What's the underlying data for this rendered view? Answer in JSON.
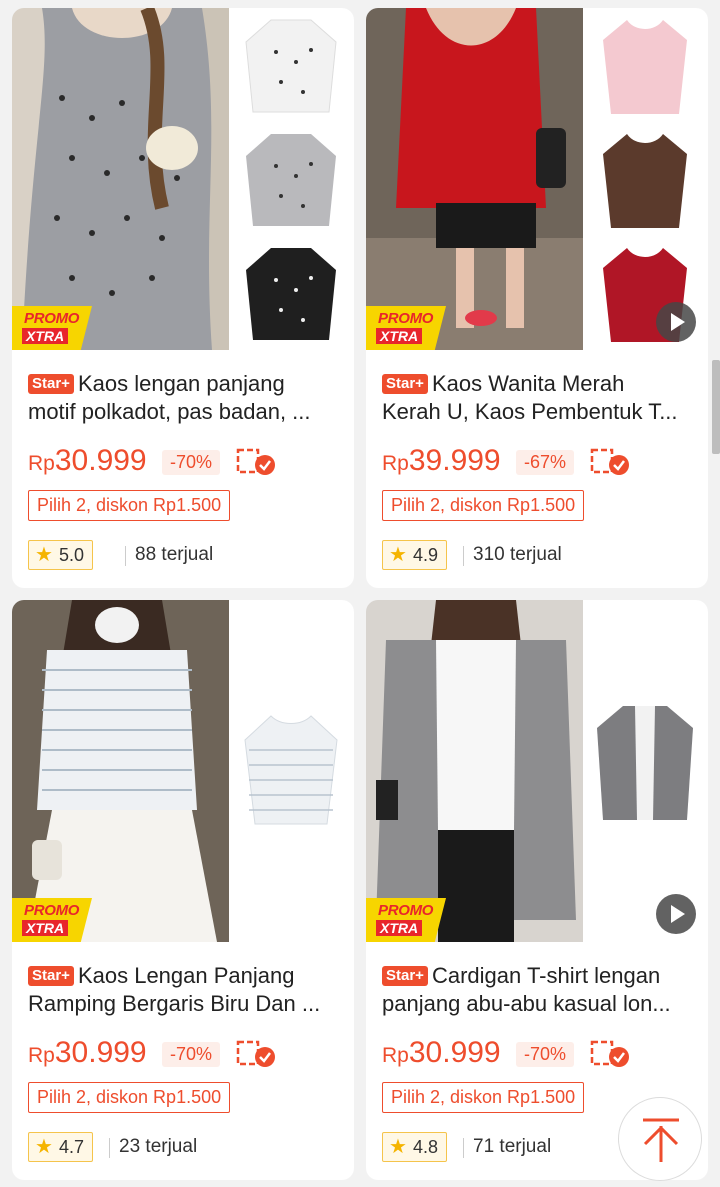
{
  "products": [
    {
      "badge": "Star+",
      "title_line1": "Kaos lengan panjang",
      "title_line2": "motif polkadot, pas badan, ...",
      "currency": "Rp",
      "price": "30.999",
      "discount": "-70%",
      "promo": "Pilih 2, diskon Rp1.500",
      "rating": "5.0",
      "sold": "88 terjual",
      "promo_badge_top": "PROMO",
      "promo_badge_bottom": "XTRA",
      "has_video": false,
      "colors": {
        "main": "#9c9ea3",
        "thumbs": [
          "#f2f2f2",
          "#b9b9bc",
          "#1f1f1f"
        ]
      }
    },
    {
      "badge": "Star+",
      "title_line1": "Kaos Wanita Merah",
      "title_line2": "Kerah U, Kaos Pembentuk T...",
      "currency": "Rp",
      "price": "39.999",
      "discount": "-67%",
      "promo": "Pilih 2, diskon Rp1.500",
      "rating": "4.9",
      "sold": "310 terjual",
      "promo_badge_top": "PROMO",
      "promo_badge_bottom": "XTRA",
      "has_video": true,
      "colors": {
        "main": "#c8161d",
        "thumbs": [
          "#f4c9d0",
          "#5b3a2c",
          "#b01626"
        ]
      }
    },
    {
      "badge": "Star+",
      "title_line1": "Kaos Lengan Panjang",
      "title_line2": "Ramping Bergaris Biru Dan ...",
      "currency": "Rp",
      "price": "30.999",
      "discount": "-70%",
      "promo": "Pilih 2, diskon Rp1.500",
      "rating": "4.7",
      "sold": "23 terjual",
      "promo_badge_top": "PROMO",
      "promo_badge_bottom": "XTRA",
      "has_video": false,
      "colors": {
        "main": "#e8ecef",
        "thumbs": [
          "#eef1f4"
        ]
      }
    },
    {
      "badge": "Star+",
      "title_line1": "Cardigan T-shirt lengan",
      "title_line2": "panjang abu-abu kasual lon...",
      "currency": "Rp",
      "price": "30.999",
      "discount": "-70%",
      "promo": "Pilih 2, diskon Rp1.500",
      "rating": "4.8",
      "sold": "71 terjual",
      "promo_badge_top": "PROMO",
      "promo_badge_bottom": "XTRA",
      "has_video": true,
      "colors": {
        "main": "#8d8d8f",
        "thumbs": [
          "#7d7d80"
        ]
      }
    }
  ],
  "accent": "#ee4d2d"
}
